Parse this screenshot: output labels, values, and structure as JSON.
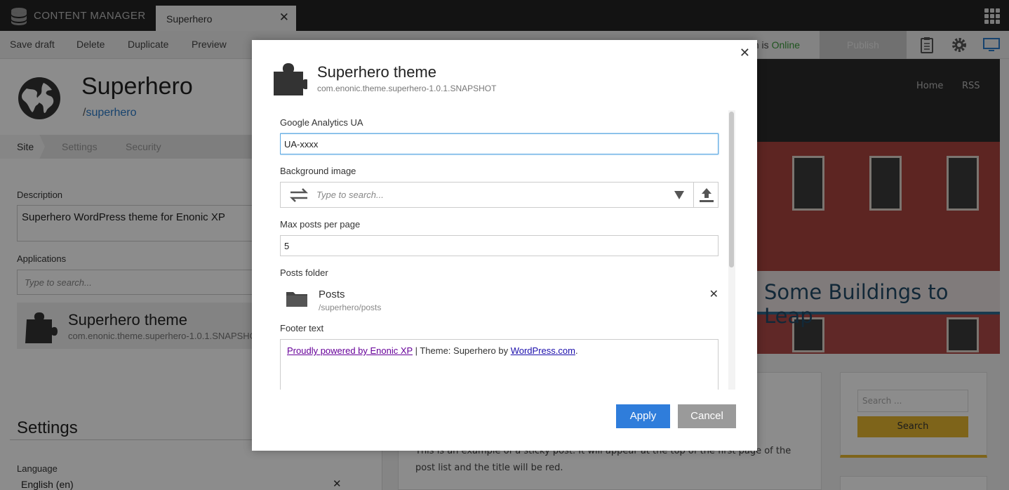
{
  "app": {
    "title": "CONTENT MANAGER",
    "tab_label": "Superhero",
    "icons": [
      "database-icon",
      "close-icon",
      "app-grid-icon"
    ]
  },
  "toolbar": {
    "save_draft": "Save draft",
    "delete": "Delete",
    "duplicate": "Duplicate",
    "preview": "Preview",
    "online_prefix": "m is ",
    "online_status": "Online",
    "publish": "Publish",
    "icons": [
      "clipboard-icon",
      "gear-icon",
      "monitor-icon"
    ],
    "colors": {
      "online": "#3a9a3a",
      "active_icon": "#2a7ac9"
    }
  },
  "site": {
    "title": "Superhero",
    "path_prefix": "/",
    "path_name": "superhero",
    "steps": [
      "Site",
      "Settings",
      "Security"
    ],
    "description_label": "Description",
    "description_value": "Superhero WordPress theme for Enonic XP",
    "applications_label": "Applications",
    "applications_placeholder": "Type to search...",
    "app_title": "Superhero theme",
    "app_key": "com.enonic.theme.superhero-1.0.1.SNAPSHOT",
    "settings_heading": "Settings",
    "language_label": "Language",
    "language_value": "English (en)"
  },
  "preview": {
    "nav": [
      "Home",
      "RSS"
    ],
    "banner": "Some Buildings to Leap",
    "post_text": "This is an example of a sticky post. It will appear at the top of the first page of the post list and the title will be red.",
    "search_placeholder": "Search ...",
    "search_button": "Search",
    "colors": {
      "accent": "#e6b730",
      "banner_text": "#214a66"
    }
  },
  "modal": {
    "title": "Superhero theme",
    "subtitle": "com.enonic.theme.superhero-1.0.1.SNAPSHOT",
    "fields": {
      "ga_label": "Google Analytics UA",
      "ga_value": "UA-xxxx",
      "bg_label": "Background image",
      "bg_placeholder": "Type to search...",
      "max_posts_label": "Max posts per page",
      "max_posts_value": "5",
      "posts_folder_label": "Posts folder",
      "posts_folder_name": "Posts",
      "posts_folder_path": "/superhero/posts",
      "footer_label": "Footer text",
      "footer_link1": "Proudly powered by Enonic XP",
      "footer_mid": " | Theme: Superhero by ",
      "footer_link2": "WordPress.com",
      "footer_end": "."
    },
    "apply": "Apply",
    "cancel": "Cancel",
    "colors": {
      "apply": "#2f7ddb",
      "cancel": "#9a9a9a",
      "focus": "#5da9e2"
    }
  }
}
